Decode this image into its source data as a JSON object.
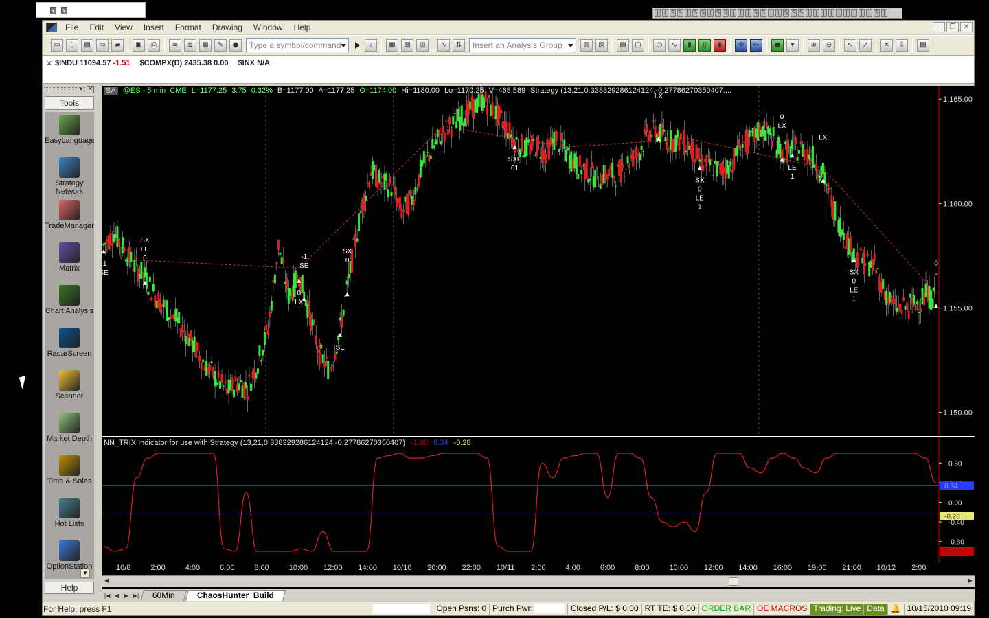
{
  "menu": {
    "items": [
      "File",
      "Edit",
      "View",
      "Insert",
      "Format",
      "Drawing",
      "Window",
      "Help"
    ]
  },
  "toolbar": {
    "symbol_placeholder": "Type a symbol/command",
    "analysis_placeholder": "Insert an Analysis Group"
  },
  "ticker": {
    "indu_sym": "$INDU",
    "indu_price": "11094.57",
    "indu_chg": "-1.51",
    "compx_sym": "$COMPX(D)",
    "compx_price": "2435.38",
    "compx_chg": "0.00",
    "inx_sym": "$INX",
    "inx_price": "N/A"
  },
  "tools": {
    "tab": "Tools",
    "help": "Help",
    "items": [
      {
        "label": "EasyLanguage",
        "icon": "easylanguage-icon"
      },
      {
        "label": "Strategy Network",
        "icon": "strategy-network-icon"
      },
      {
        "label": "TradeManager",
        "icon": "trademanager-icon"
      },
      {
        "label": "Matrix",
        "icon": "matrix-icon"
      },
      {
        "label": "Chart Analysis",
        "icon": "chart-analysis-icon"
      },
      {
        "label": "RadarScreen",
        "icon": "radarscreen-icon"
      },
      {
        "label": "Scanner",
        "icon": "scanner-icon"
      },
      {
        "label": "Market Depth",
        "icon": "market-depth-icon"
      },
      {
        "label": "Time & Sales",
        "icon": "time-and-sales-icon"
      },
      {
        "label": "Hot Lists",
        "icon": "hot-lists-icon"
      },
      {
        "label": "OptionStation",
        "icon": "optionstation-icon"
      }
    ]
  },
  "chart": {
    "sa": "SA",
    "symbol": "@ES - 5 min  CME",
    "last": "L=1177.25",
    "chg": "3.75",
    "pct": "0.32%",
    "bid": "B=1177.00",
    "ask": "A=1177.25",
    "open": "O=1174.00",
    "high": "Hi=1180.00",
    "low": "Lo=1170.25",
    "vol": "V=468,589",
    "strategy": "Strategy (13,21,0.338329286124124,-0.27786270350407,..."
  },
  "chart_data": {
    "type": "line",
    "price_axis": {
      "ticks": [
        "1,165.00",
        "1,160.00",
        "1,155.00",
        "1,150.00"
      ],
      "ylim": [
        1149,
        1165.5
      ]
    },
    "time_axis": {
      "ticks": [
        "10/8",
        "2:00",
        "4:00",
        "6:00",
        "8:00",
        "10:00",
        "12:00",
        "14:00",
        "10/10",
        "20:00",
        "22:00",
        "10/11",
        "2:00",
        "4:00",
        "6:00",
        "8:00",
        "10:00",
        "12:00",
        "14:00",
        "16:00",
        "19:00",
        "21:00",
        "10/12",
        "2:00"
      ]
    },
    "price_series": [
      1158,
      1158.6,
      1157.8,
      1157,
      1156.5,
      1155.6,
      1155,
      1154.4,
      1153.8,
      1153,
      1152.2,
      1151.6,
      1151,
      1151.4,
      1151.2,
      1152.4,
      1154,
      1158,
      1155.6,
      1156.6,
      1154.8,
      1152.8,
      1152,
      1154,
      1156.8,
      1159.6,
      1161.6,
      1161,
      1160.8,
      1159.6,
      1160.2,
      1161.8,
      1162.6,
      1163.4,
      1163.8,
      1164.2,
      1164.6,
      1165,
      1164.4,
      1163.8,
      1163,
      1162.6,
      1162.8,
      1162.4,
      1163.2,
      1162.4,
      1161.8,
      1161.6,
      1161.2,
      1161.4,
      1161.4,
      1162,
      1162.4,
      1163.4,
      1163.4,
      1163,
      1163,
      1162.8,
      1162,
      1161.8,
      1161.6,
      1161.8,
      1162.8,
      1163,
      1163.6,
      1163.2,
      1162.4,
      1162.6,
      1162.6,
      1162.2,
      1161.4,
      1159.8,
      1158.6,
      1157.6,
      1157.2,
      1157,
      1155.8,
      1155,
      1155,
      1155.2,
      1155.6,
      1155.4
    ],
    "signals": [
      {
        "text": [
          "-1",
          "SE"
        ],
        "color": "#ffffff"
      },
      {
        "text": [
          "SX",
          "LE",
          "0"
        ],
        "color": "#ffffff"
      },
      {
        "text": [
          "0",
          "LX"
        ],
        "color": "#ffffff"
      },
      {
        "text": [
          "-1",
          "SE"
        ],
        "color": "#ffffff"
      },
      {
        "text": [
          "SE"
        ],
        "color": "#ffffff"
      },
      {
        "text": [
          "SX",
          "0"
        ],
        "color": "#ffffff"
      },
      {
        "text": [
          "SXE",
          "01"
        ],
        "color": "#ffffff"
      },
      {
        "text": [
          "LX"
        ],
        "color": "#ffffff"
      },
      {
        "text": [
          "SX",
          "0",
          "LE",
          "1"
        ],
        "color": "#ffffff"
      },
      {
        "text": [
          "0",
          "LX"
        ],
        "color": "#ffffff"
      },
      {
        "text": [
          "LE",
          "1"
        ],
        "color": "#ffffff"
      },
      {
        "text": [
          "LX"
        ],
        "color": "#ffffff"
      },
      {
        "text": [
          "SX",
          "0",
          "LE",
          "1"
        ],
        "color": "#ffffff"
      },
      {
        "text": [
          "0",
          "L"
        ],
        "color": "#ffffff"
      }
    ],
    "indicator": {
      "title": "NN_TRIX Indicator for use with Strategy (13,21,0.338329286124124,-0.27786270350407)",
      "v1": "-1.00",
      "v2": "0.34",
      "v3": "-0.28",
      "ylim": [
        -1,
        1
      ],
      "ticks": [
        "0.80",
        "0.40",
        "0.00",
        "-0.40",
        "-0.80"
      ],
      "line_blue": 0.34,
      "line_yellow": -0.28,
      "markers": [
        "0.34",
        "-0.28",
        "-1.00"
      ],
      "series": [
        -0.9,
        -1,
        -0.95,
        0.5,
        0.9,
        1,
        1,
        1,
        1,
        1,
        1,
        -0.95,
        -1,
        0.2,
        -1,
        -1,
        -1,
        -1,
        -0.95,
        -1,
        -0.6,
        -1,
        -1,
        -1,
        -1,
        0.9,
        0.95,
        1,
        0.9,
        0.9,
        0.95,
        1,
        1,
        1,
        1,
        0.9,
        -0.9,
        -1,
        -1,
        -1,
        0.8,
        0.5,
        0.9,
        0.95,
        1,
        1,
        0.1,
        1,
        1,
        0.9,
        0.1,
        -0.4,
        -0.5,
        -0.4,
        -0.6,
        0.2,
        1,
        1,
        1,
        0.7,
        0.6,
        0.9,
        1,
        0.9,
        0.7,
        0.6,
        0.9,
        1,
        1,
        1,
        1,
        1,
        1,
        1,
        1,
        0.9,
        0.4
      ]
    }
  },
  "tabs": [
    "60Min",
    "ChaosHunter_Build"
  ],
  "status": {
    "help": "For Help, press F1",
    "open_psns": "Open Psns: 0",
    "purch": "Purch Pwr:",
    "closed_pl": "Closed P/L: $ 0.00",
    "rt_te": "RT TE: $ 0.00",
    "order_bar": "ORDER BAR",
    "oe_macros": "OE MACROS",
    "trading": "Trading: Live",
    "data": "Data",
    "datetime": "10/15/2010 09:19"
  }
}
